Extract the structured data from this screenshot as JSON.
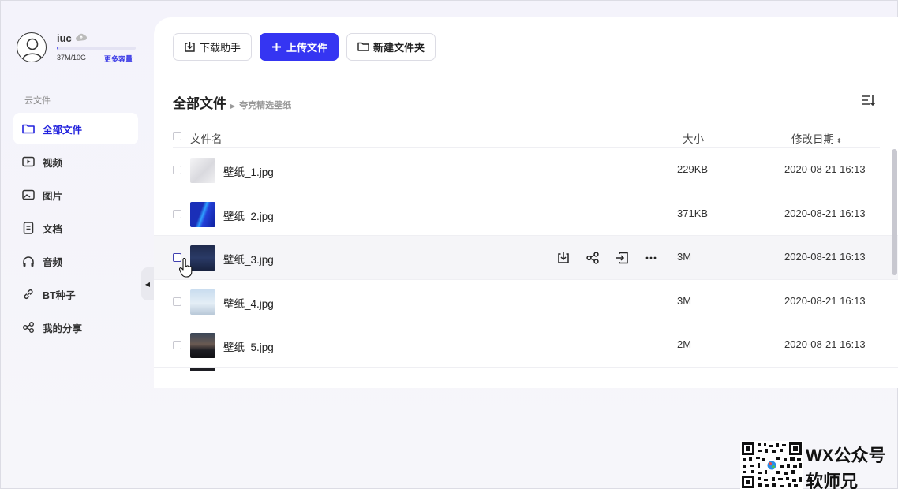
{
  "user": {
    "name": "iuc",
    "quota_used_text": "37M/10G",
    "quota_fraction": 0.0037,
    "more_space_label": "更多容量"
  },
  "sidebar": {
    "section_title": "云文件",
    "items": [
      {
        "label": "全部文件",
        "icon": "folder-icon",
        "active": true
      },
      {
        "label": "视频",
        "icon": "video-icon",
        "active": false
      },
      {
        "label": "图片",
        "icon": "image-icon",
        "active": false
      },
      {
        "label": "文档",
        "icon": "document-icon",
        "active": false
      },
      {
        "label": "音频",
        "icon": "headphones-icon",
        "active": false
      },
      {
        "label": "BT种子",
        "icon": "link-icon",
        "active": false
      },
      {
        "label": "我的分享",
        "icon": "share-icon",
        "active": false
      }
    ]
  },
  "toolbar": {
    "download_helper_label": "下载助手",
    "upload_label": "上传文件",
    "new_folder_label": "新建文件夹"
  },
  "breadcrumb": {
    "root": "全部文件",
    "current": "夸克精选壁纸"
  },
  "table": {
    "headers": {
      "name": "文件名",
      "size": "大小",
      "date": "修改日期"
    },
    "rows": [
      {
        "name": "壁纸_1.jpg",
        "size": "229KB",
        "date": "2020-08-21 16:13"
      },
      {
        "name": "壁纸_2.jpg",
        "size": "371KB",
        "date": "2020-08-21 16:13"
      },
      {
        "name": "壁纸_3.jpg",
        "size": "3M",
        "date": "2020-08-21 16:13"
      },
      {
        "name": "壁纸_4.jpg",
        "size": "3M",
        "date": "2020-08-21 16:13"
      },
      {
        "name": "壁纸_5.jpg",
        "size": "2M",
        "date": "2020-08-21 16:13"
      }
    ]
  },
  "colors": {
    "accent": "#3535f2",
    "active_nav_text": "#2222dd"
  },
  "watermark": {
    "line1": "WX公众号",
    "line2": "软师兄"
  }
}
